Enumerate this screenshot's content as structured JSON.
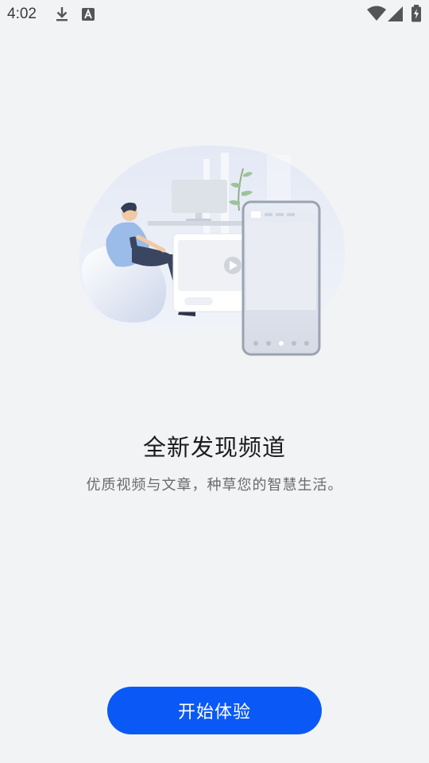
{
  "status_bar": {
    "time": "4:02",
    "icons": [
      "download-icon",
      "a-icon",
      "wifi-icon",
      "signal-icon",
      "battery-charging-icon"
    ]
  },
  "onboarding": {
    "title": "全新发现频道",
    "subtitle": "优质视频与文章，种草您的智慧生活。",
    "start_button_label": "开始体验"
  },
  "colors": {
    "background": "#f1f3f5",
    "accent": "#0a59f7"
  }
}
